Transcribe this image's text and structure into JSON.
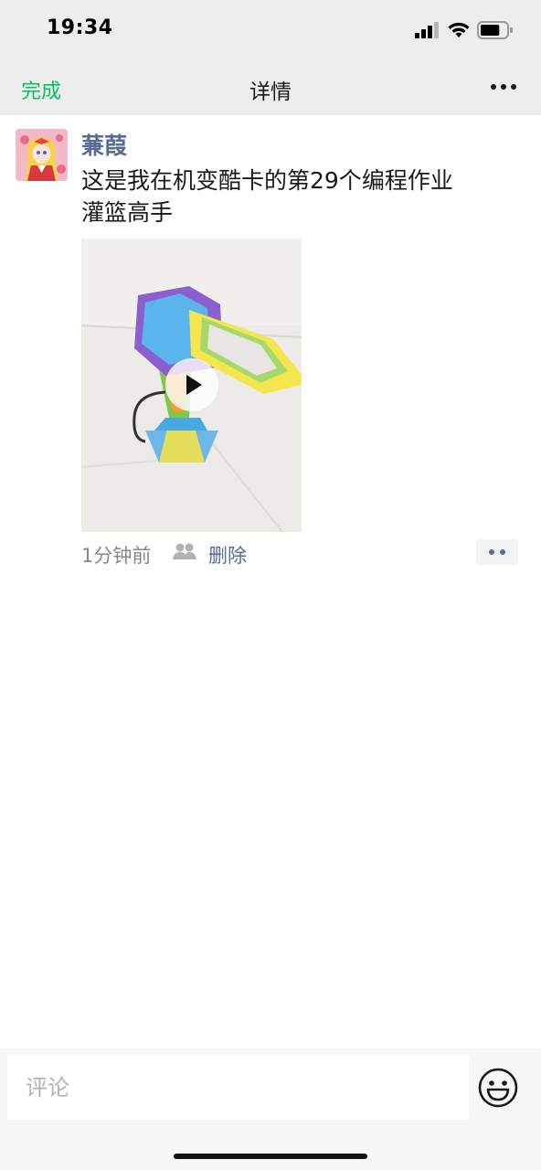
{
  "status_bar": {
    "time": "19:34",
    "battery_percent": 75
  },
  "nav": {
    "done_label": "完成",
    "title": "详情",
    "more_icon": "more-dots-icon"
  },
  "post": {
    "author": "蒹葭",
    "text": "这是我在机变酷卡的第29个编程作业\n灌篮高手",
    "media_type": "video",
    "time_ago": "1分钟前",
    "visibility_icon": "friends-icon",
    "delete_label": "删除",
    "action_icon": "two-dots-icon"
  },
  "comment": {
    "placeholder": "评论",
    "emoji_icon": "smiley-face-icon"
  },
  "colors": {
    "accent_green": "#07c160",
    "link_blue": "#576b95",
    "header_bg": "#ededed"
  }
}
